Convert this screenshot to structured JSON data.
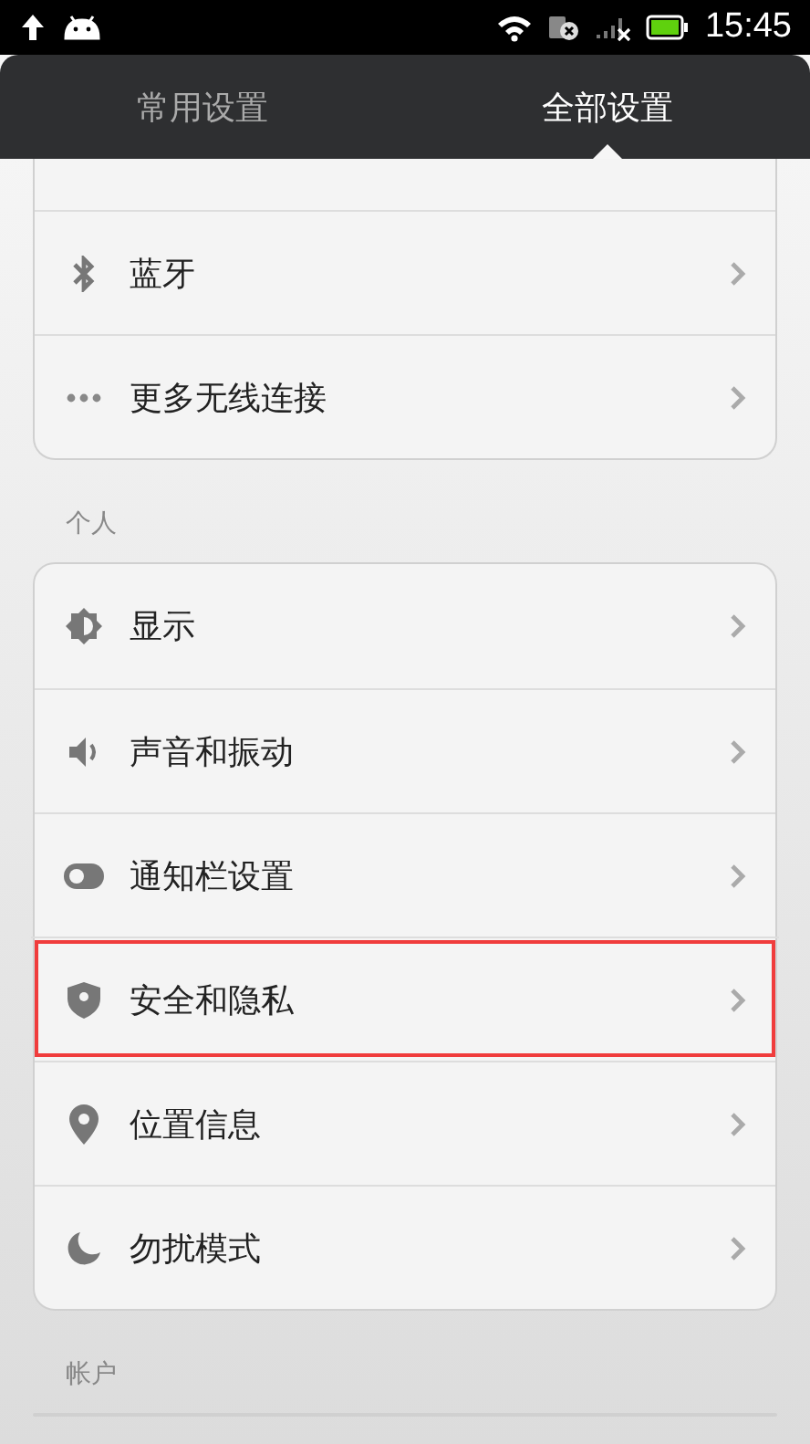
{
  "status_bar": {
    "time": "15:45"
  },
  "tabs": [
    {
      "label": "常用设置",
      "selected": false
    },
    {
      "label": "全部设置",
      "selected": true
    }
  ],
  "sections": [
    {
      "items": [
        {
          "kind": "bluetooth",
          "label": "蓝牙",
          "highlighted": false
        },
        {
          "kind": "more",
          "label": "更多无线连接",
          "highlighted": false
        }
      ]
    },
    {
      "title": "个人",
      "items": [
        {
          "kind": "display",
          "label": "显示",
          "highlighted": false
        },
        {
          "kind": "sound",
          "label": "声音和振动",
          "highlighted": false
        },
        {
          "kind": "toggle",
          "label": "通知栏设置",
          "highlighted": false
        },
        {
          "kind": "shield",
          "label": "安全和隐私",
          "highlighted": true
        },
        {
          "kind": "location",
          "label": "位置信息",
          "highlighted": false
        },
        {
          "kind": "moon",
          "label": "勿扰模式",
          "highlighted": false
        }
      ]
    },
    {
      "title": "帐户"
    }
  ]
}
